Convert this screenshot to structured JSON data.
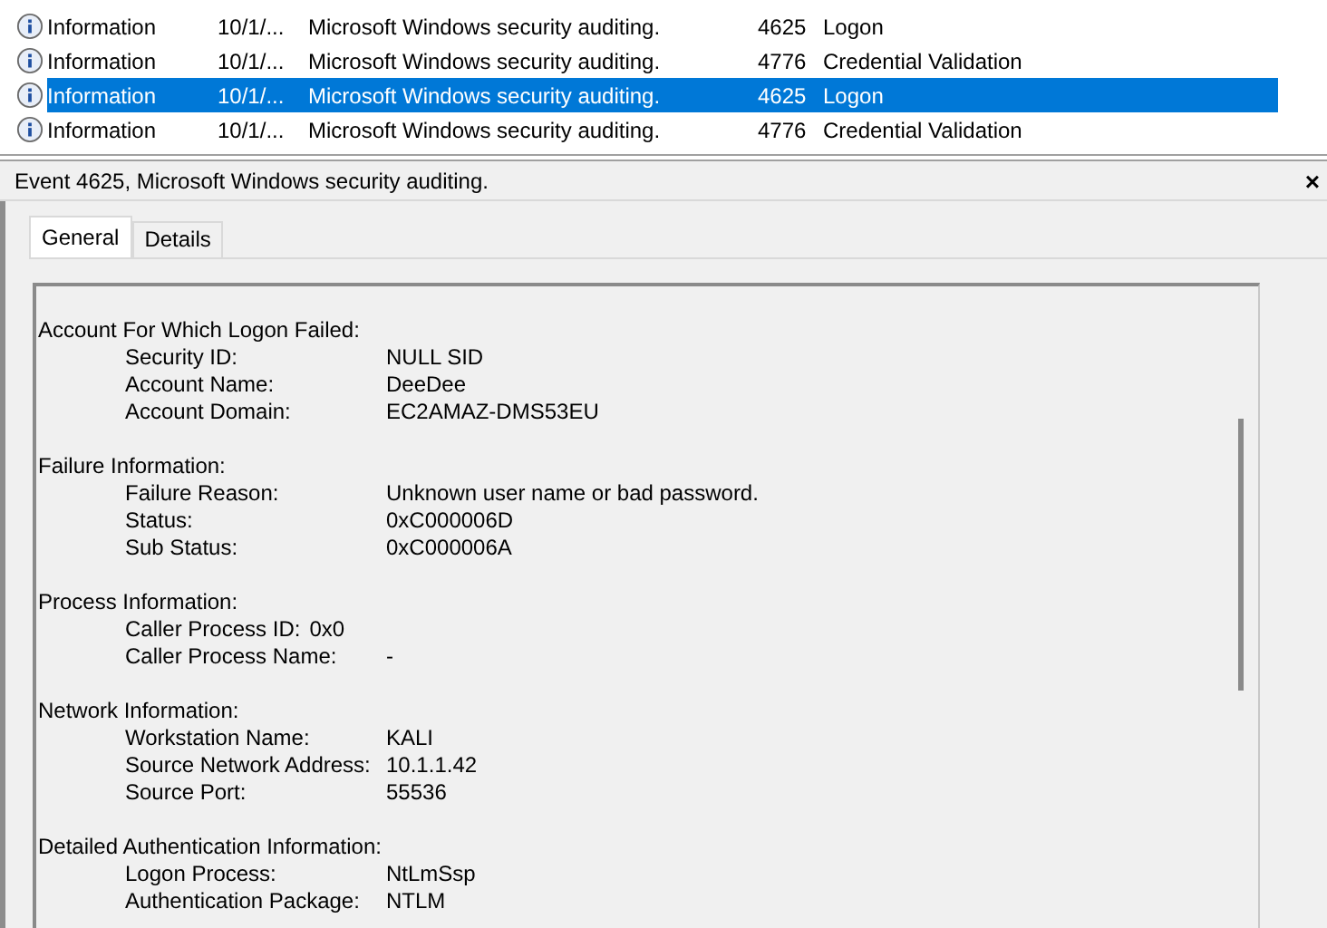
{
  "events": [
    {
      "level": "Information",
      "date": "10/1/...",
      "source": "Microsoft Windows security auditing.",
      "event_id": "4625",
      "category": "Logon",
      "selected": false
    },
    {
      "level": "Information",
      "date": "10/1/...",
      "source": "Microsoft Windows security auditing.",
      "event_id": "4776",
      "category": "Credential Validation",
      "selected": false
    },
    {
      "level": "Information",
      "date": "10/1/...",
      "source": "Microsoft Windows security auditing.",
      "event_id": "4625",
      "category": "Logon",
      "selected": true
    },
    {
      "level": "Information",
      "date": "10/1/...",
      "source": "Microsoft Windows security auditing.",
      "event_id": "4776",
      "category": "Credential Validation",
      "selected": false
    }
  ],
  "detail": {
    "title": "Event 4625, Microsoft Windows security auditing.",
    "close": "×",
    "tabs": [
      {
        "label": "General",
        "selected": true
      },
      {
        "label": "Details",
        "selected": false
      }
    ],
    "sections": [
      {
        "heading": "Account For Which Logon Failed:",
        "fields": [
          {
            "label": "Security ID:",
            "value": "NULL SID",
            "kind": "column"
          },
          {
            "label": "Account Name:",
            "value": "DeeDee",
            "kind": "column"
          },
          {
            "label": "Account Domain:",
            "value": "EC2AMAZ-DMS53EU",
            "kind": "column"
          }
        ]
      },
      {
        "heading": "Failure Information:",
        "fields": [
          {
            "label": "Failure Reason:",
            "value": "Unknown user name or bad password.",
            "kind": "column"
          },
          {
            "label": "Status:",
            "value": "0xC000006D",
            "kind": "column"
          },
          {
            "label": "Sub Status:",
            "value": "0xC000006A",
            "kind": "column"
          }
        ]
      },
      {
        "heading": "Process Information:",
        "fields": [
          {
            "label": "Caller Process ID:",
            "value": "0x0",
            "kind": "inline"
          },
          {
            "label": "Caller Process Name:",
            "value": "-",
            "kind": "column"
          }
        ]
      },
      {
        "heading": "Network Information:",
        "fields": [
          {
            "label": "Workstation Name:",
            "value": "KALI",
            "kind": "column"
          },
          {
            "label": "Source Network Address:",
            "value": "10.1.1.42",
            "kind": "column"
          },
          {
            "label": "Source Port:",
            "value": "55536",
            "kind": "column"
          }
        ]
      },
      {
        "heading": "Detailed Authentication Information:",
        "fields": [
          {
            "label": "Logon Process:",
            "value": "NtLmSsp",
            "kind": "column"
          },
          {
            "label": "Authentication Package:",
            "value": "NTLM",
            "kind": "column"
          }
        ]
      }
    ]
  }
}
